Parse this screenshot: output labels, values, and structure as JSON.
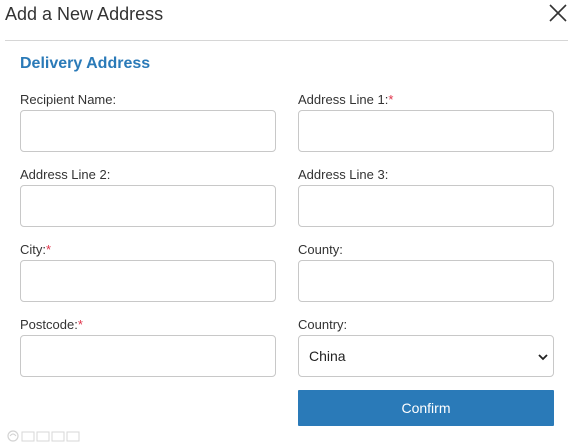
{
  "dialog": {
    "title": "Add a New Address",
    "close_icon": "close-icon"
  },
  "section": {
    "title": "Delivery Address"
  },
  "fields": {
    "recipient_name": {
      "label": "Recipient Name:",
      "value": ""
    },
    "address_line_1": {
      "label": "Address Line 1:",
      "required_mark": "*",
      "value": ""
    },
    "address_line_2": {
      "label": "Address Line 2:",
      "value": ""
    },
    "address_line_3": {
      "label": "Address Line 3:",
      "value": ""
    },
    "city": {
      "label": "City:",
      "required_mark": "*",
      "value": ""
    },
    "county": {
      "label": "County:",
      "value": ""
    },
    "postcode": {
      "label": "Postcode:",
      "required_mark": "*",
      "value": ""
    },
    "country": {
      "label": "Country:",
      "selected": "China",
      "icon": "chevron-down-icon"
    }
  },
  "actions": {
    "confirm_label": "Confirm"
  },
  "colors": {
    "accent": "#2a7ab8",
    "required": "#e0334a",
    "border": "#c8c8c8"
  }
}
